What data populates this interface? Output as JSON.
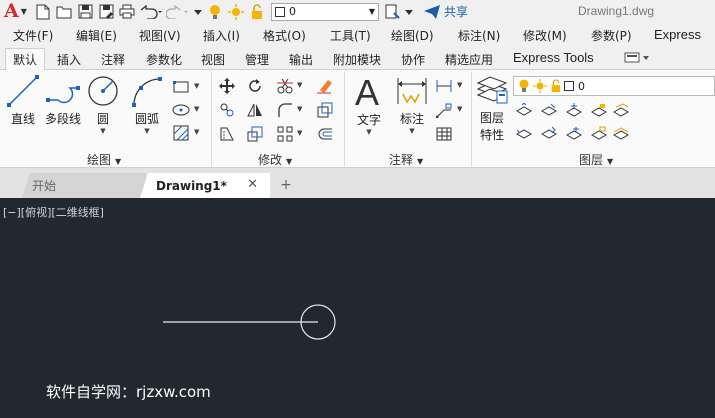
{
  "app": {
    "logo_letter": "A",
    "document_title": "Drawing1.dwg",
    "share_label": "共享",
    "layer_value": "0",
    "accent_color": "#d9262b",
    "share_color": "#1e5ca8"
  },
  "quick_access_icons": [
    "new-icon",
    "open-icon",
    "save-icon",
    "saveas-icon",
    "print-icon",
    "undo-icon",
    "redo-icon",
    "layer-bulb-icon",
    "layer-sun-icon",
    "layer-lock-icon",
    "layer-state-icon"
  ],
  "menu": {
    "items": [
      "文件(F)",
      "编辑(E)",
      "视图(V)",
      "插入(I)",
      "格式(O)",
      "工具(T)",
      "绘图(D)",
      "标注(N)",
      "修改(M)",
      "参数(P)",
      "Express"
    ]
  },
  "ribbon_tabs": {
    "items": [
      "默认",
      "插入",
      "注释",
      "参数化",
      "视图",
      "管理",
      "输出",
      "附加模块",
      "协作",
      "精选应用",
      "Express Tools"
    ],
    "active_index": 0
  },
  "panels": {
    "draw": {
      "title": "绘图",
      "line": "直线",
      "polyline": "多段线",
      "circle": "圆",
      "arc": "圆弧"
    },
    "modify": {
      "title": "修改"
    },
    "annotation": {
      "title": "注释",
      "text": "文字",
      "dimension": "标注"
    },
    "layers": {
      "title": "图层",
      "properties_line1": "图层",
      "properties_line2": "特性",
      "current_layer": "0"
    }
  },
  "file_tabs": {
    "start": "开始",
    "drawing": "Drawing1*",
    "close": "✕",
    "add": "+"
  },
  "canvas": {
    "viewport_label": "[−][俯视][二维线框]",
    "background": "#212830",
    "watermark": "软件自学网：rjzxw.com"
  }
}
